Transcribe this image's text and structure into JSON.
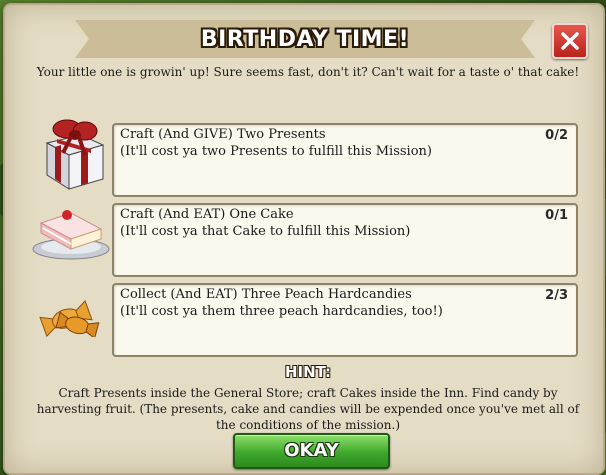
{
  "dialog": {
    "title": "BIRTHDAY TIME!",
    "subtitle": "Your little one is growin' up! Sure seems fast, don't it? Can't wait for a taste o' that cake!",
    "close_icon": "close-x-icon"
  },
  "missions": [
    {
      "name": "Craft (And GIVE) Two Presents",
      "cost": "(It'll cost ya two Presents to fulfill this Mission)",
      "progress": "0/2",
      "icon": "present-icon"
    },
    {
      "name": "Craft (And EAT) One Cake",
      "cost": "(It'll cost ya that Cake to fulfill this Mission)",
      "progress": "0/1",
      "icon": "cake-icon"
    },
    {
      "name": "Collect (And EAT) Three Peach Hardcandies",
      "cost": "(It'll cost ya them three peach hardcandies, too!)",
      "progress": "2/3",
      "icon": "candy-icon"
    }
  ],
  "hint": {
    "label": "HINT:",
    "text": "Craft Presents inside the General Store; craft Cakes inside the Inn. Find candy by harvesting fruit. (The presents, cake and candies will be expended once you've met all of the conditions of the mission.)"
  },
  "okay_label": "OKAY",
  "colors": {
    "close_button": "#c9302a",
    "okay_button": "#4cb834",
    "panel": "#e4dcc4"
  }
}
